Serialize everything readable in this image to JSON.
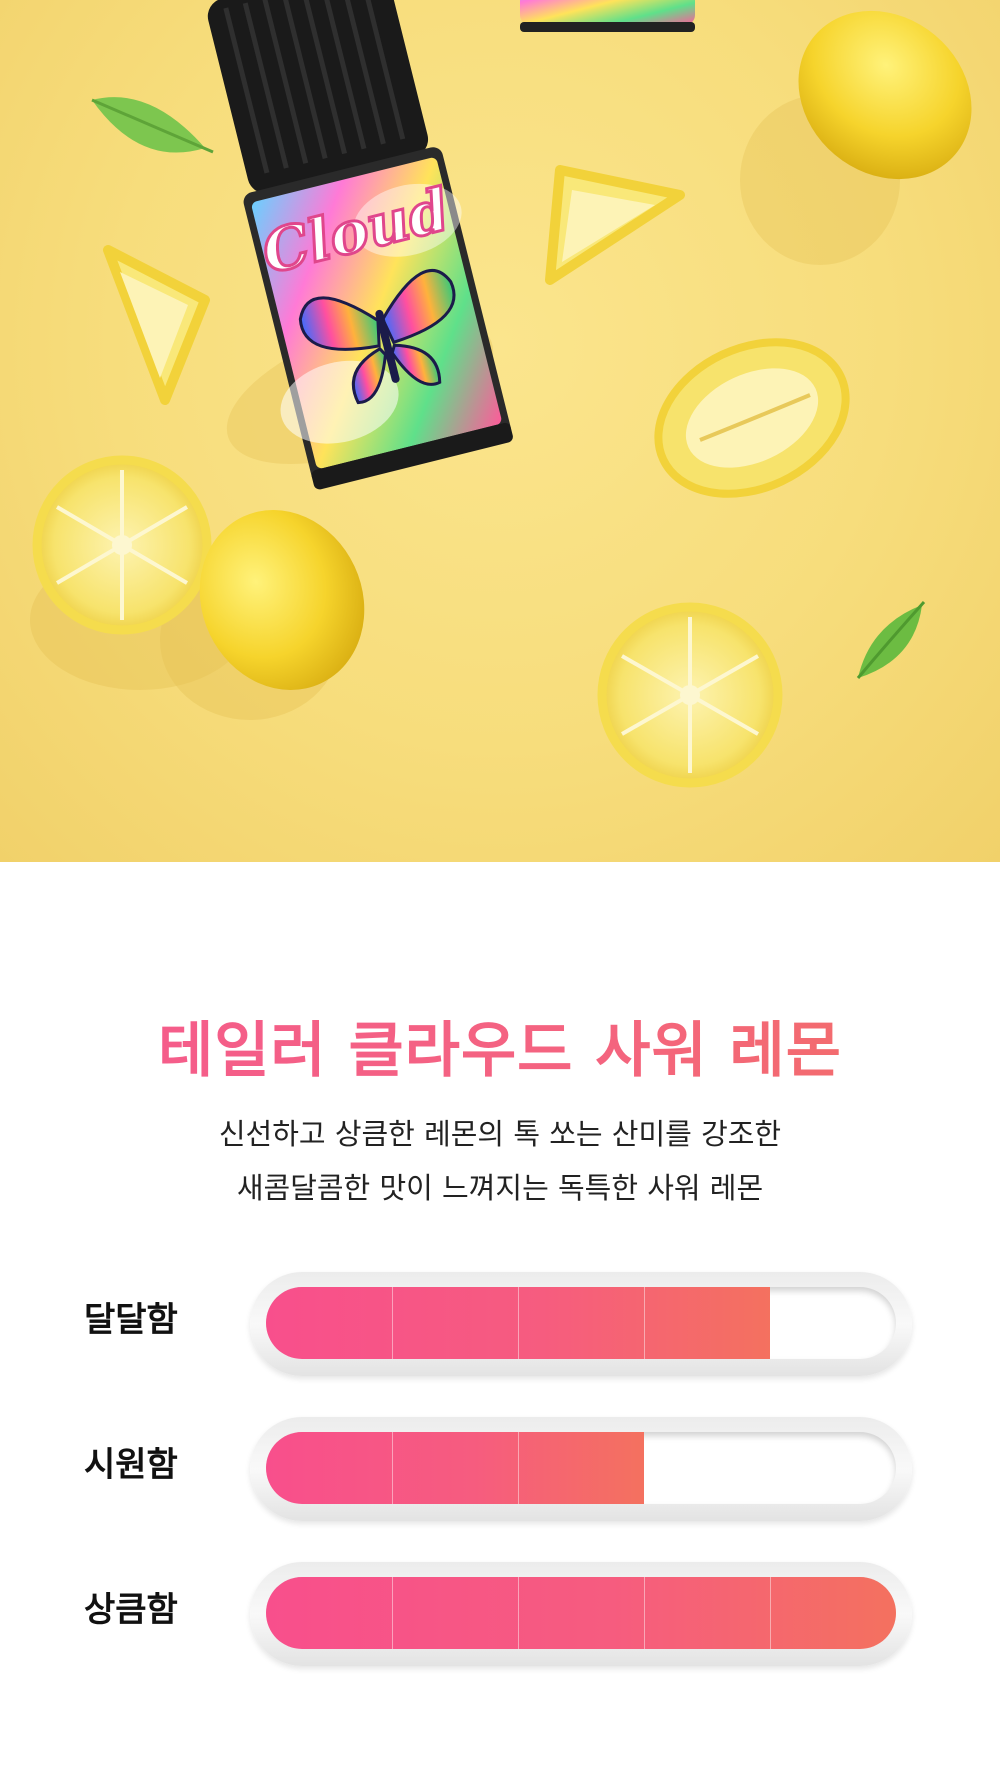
{
  "product": {
    "title": "테일러 클라우드 사워 레몬",
    "description_lines": [
      "신선하고 상큼한 레몬의 톡 쏘는 산미를 강조한",
      "새콤달콤한 맛이 느껴지는 독특한 사워 레몬"
    ]
  },
  "colors": {
    "accent_pink": "#f84f8c",
    "accent_coral": "#f4715f",
    "hero_background": "#f7dd7c"
  },
  "hero_image": {
    "bottle_label_text": "Cloud",
    "icons": [
      "bottle-icon",
      "butterfly-icon",
      "lemon-icon",
      "leaf-icon"
    ]
  },
  "meters": [
    {
      "label": "달달함",
      "level": 4,
      "max": 5
    },
    {
      "label": "시원함",
      "level": 3,
      "max": 5
    },
    {
      "label": "상큼함",
      "level": 5,
      "max": 5
    }
  ]
}
